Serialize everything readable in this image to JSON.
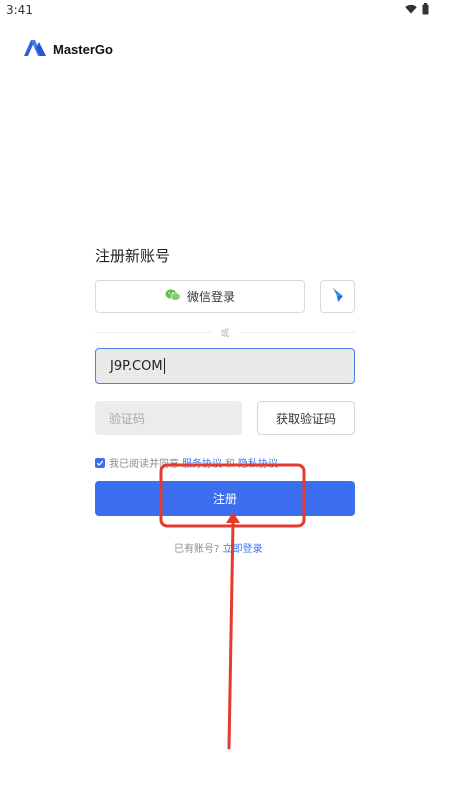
{
  "status_bar": {
    "time": "3:41",
    "wifi_icon": "wifi-icon",
    "battery_icon": "battery-icon"
  },
  "app": {
    "name": "MasterGo",
    "logo_icon": "mastergo-logo-icon"
  },
  "page": {
    "title": "注册新账号"
  },
  "social_login": {
    "wechat_label": "微信登录",
    "wechat_icon": "wechat-icon",
    "alt_icon": "feishu-icon",
    "divider_text": "或"
  },
  "form": {
    "account_value": "J9P.COM",
    "code_placeholder": "验证码",
    "get_code_label": "获取验证码"
  },
  "agreement": {
    "checked": true,
    "prefix": "我已阅读并同意",
    "terms_link": "服务协议",
    "and": "和",
    "privacy_link": "隐私协议"
  },
  "register_button": {
    "label": "注册"
  },
  "login_prompt": {
    "text": "已有账号?",
    "link": "立即登录"
  },
  "colors": {
    "primary": "#3b6ff0",
    "annotation": "#e53a2e"
  }
}
